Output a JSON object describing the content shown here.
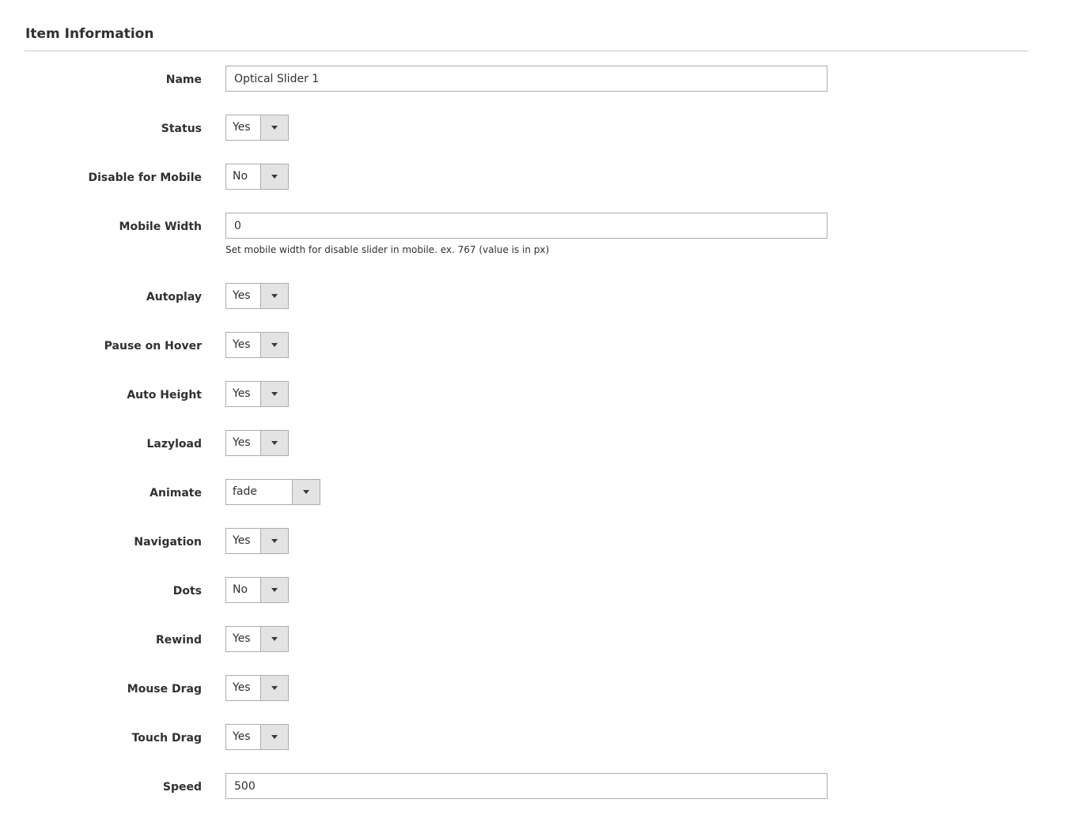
{
  "section": {
    "title": "Item Information"
  },
  "fields": {
    "name": {
      "label": "Name",
      "value": "Optical Slider 1"
    },
    "status": {
      "label": "Status",
      "value": "Yes"
    },
    "disable_mobile": {
      "label": "Disable for Mobile",
      "value": "No"
    },
    "mobile_width": {
      "label": "Mobile Width",
      "value": "0",
      "note": "Set mobile width for disable slider in mobile. ex. 767 (value is in px)"
    },
    "autoplay": {
      "label": "Autoplay",
      "value": "Yes"
    },
    "pause_hover": {
      "label": "Pause on Hover",
      "value": "Yes"
    },
    "auto_height": {
      "label": "Auto Height",
      "value": "Yes"
    },
    "lazyload": {
      "label": "Lazyload",
      "value": "Yes"
    },
    "animate": {
      "label": "Animate",
      "value": "fade"
    },
    "navigation": {
      "label": "Navigation",
      "value": "Yes"
    },
    "dots": {
      "label": "Dots",
      "value": "No"
    },
    "rewind": {
      "label": "Rewind",
      "value": "Yes"
    },
    "mouse_drag": {
      "label": "Mouse Drag",
      "value": "Yes"
    },
    "touch_drag": {
      "label": "Touch Drag",
      "value": "Yes"
    },
    "speed": {
      "label": "Speed",
      "value": "500"
    }
  },
  "icons": {
    "select_arrow": "chevron-down-icon"
  }
}
